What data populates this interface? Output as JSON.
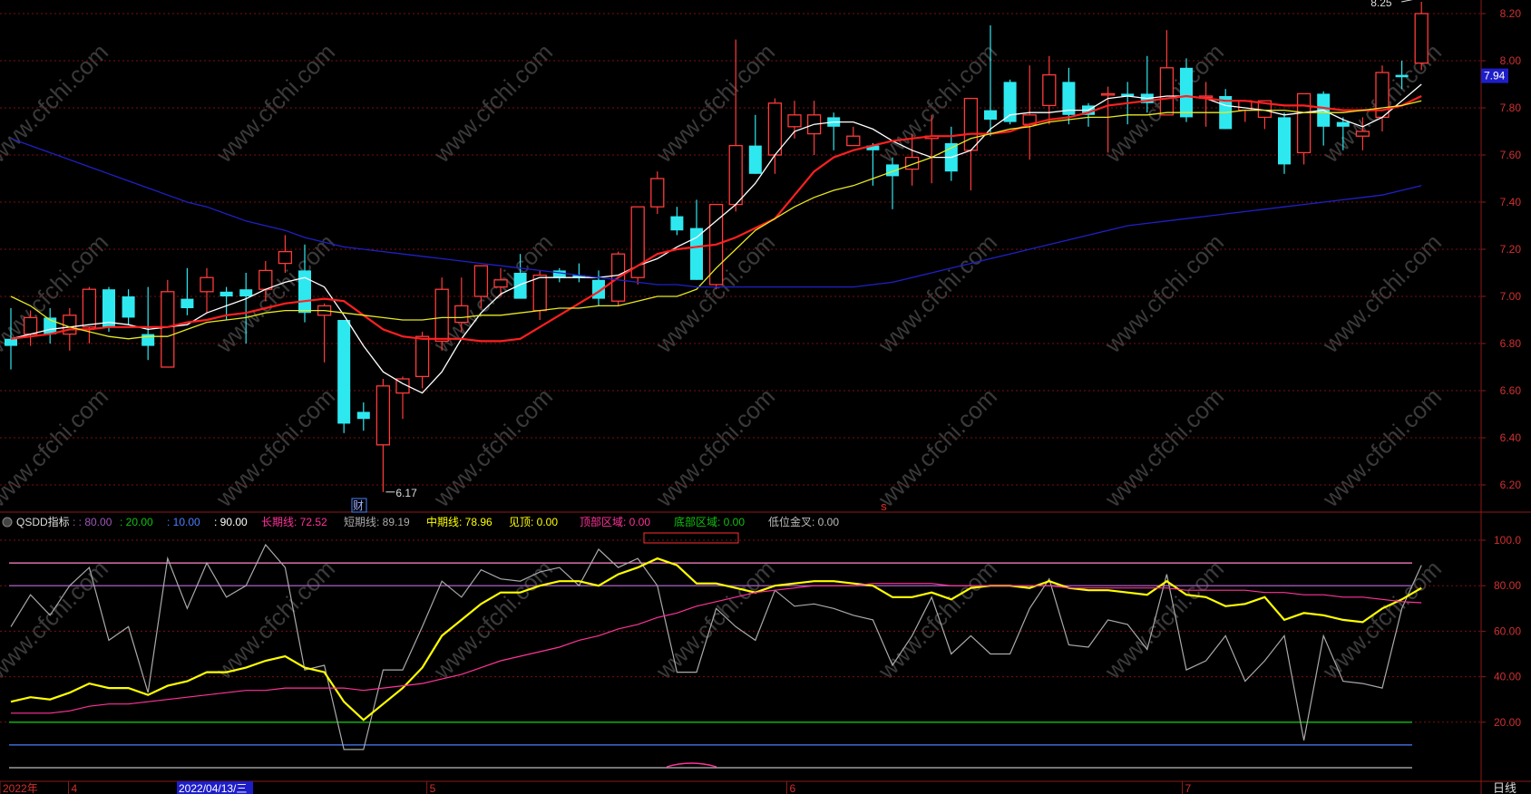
{
  "chart_data": [
    {
      "type": "candlestick",
      "ylim": [
        6.1,
        8.3
      ],
      "y_ticks": [
        "8.20",
        "8.00",
        "7.80",
        "7.60",
        "7.40",
        "7.20",
        "7.00",
        "6.80",
        "6.60",
        "6.40",
        "6.20"
      ],
      "last_price": "7.94",
      "high_label": "8.25",
      "low_label": "6.17",
      "event_label": "财",
      "marker_label": "S",
      "candles": [
        {
          "o": 6.82,
          "h": 6.95,
          "l": 6.69,
          "c": 6.79
        },
        {
          "o": 6.84,
          "h": 6.94,
          "l": 6.79,
          "c": 6.91
        },
        {
          "o": 6.91,
          "h": 6.95,
          "l": 6.8,
          "c": 6.84
        },
        {
          "o": 6.84,
          "h": 6.95,
          "l": 6.77,
          "c": 6.92
        },
        {
          "o": 6.87,
          "h": 7.04,
          "l": 6.8,
          "c": 7.03
        },
        {
          "o": 7.03,
          "h": 7.04,
          "l": 6.85,
          "c": 6.87
        },
        {
          "o": 7.0,
          "h": 7.03,
          "l": 6.88,
          "c": 6.91
        },
        {
          "o": 6.84,
          "h": 7.04,
          "l": 6.73,
          "c": 6.79
        },
        {
          "o": 6.7,
          "h": 7.07,
          "l": 6.7,
          "c": 7.02
        },
        {
          "o": 6.99,
          "h": 7.12,
          "l": 6.92,
          "c": 6.95
        },
        {
          "o": 7.02,
          "h": 7.12,
          "l": 6.93,
          "c": 7.08
        },
        {
          "o": 7.02,
          "h": 7.04,
          "l": 6.9,
          "c": 7.0
        },
        {
          "o": 7.03,
          "h": 7.1,
          "l": 6.8,
          "c": 7.0
        },
        {
          "o": 7.03,
          "h": 7.15,
          "l": 6.98,
          "c": 7.11
        },
        {
          "o": 7.14,
          "h": 7.26,
          "l": 7.1,
          "c": 7.19
        },
        {
          "o": 7.11,
          "h": 7.22,
          "l": 6.89,
          "c": 6.93
        },
        {
          "o": 6.92,
          "h": 6.97,
          "l": 6.72,
          "c": 6.96
        },
        {
          "o": 6.9,
          "h": 6.9,
          "l": 6.42,
          "c": 6.46
        },
        {
          "o": 6.51,
          "h": 6.55,
          "l": 6.43,
          "c": 6.48
        },
        {
          "o": 6.37,
          "h": 6.65,
          "l": 6.17,
          "c": 6.62
        },
        {
          "o": 6.59,
          "h": 6.66,
          "l": 6.48,
          "c": 6.65
        },
        {
          "o": 6.66,
          "h": 6.85,
          "l": 6.61,
          "c": 6.83
        },
        {
          "o": 6.81,
          "h": 7.08,
          "l": 6.77,
          "c": 7.03
        },
        {
          "o": 6.89,
          "h": 7.08,
          "l": 6.85,
          "c": 6.96
        },
        {
          "o": 7.0,
          "h": 7.13,
          "l": 6.95,
          "c": 7.13
        },
        {
          "o": 7.04,
          "h": 7.12,
          "l": 7.0,
          "c": 7.07
        },
        {
          "o": 7.1,
          "h": 7.18,
          "l": 7.0,
          "c": 6.99
        },
        {
          "o": 6.94,
          "h": 7.11,
          "l": 6.9,
          "c": 7.09
        },
        {
          "o": 7.11,
          "h": 7.12,
          "l": 7.06,
          "c": 7.08
        },
        {
          "o": 7.09,
          "h": 7.14,
          "l": 7.06,
          "c": 7.08
        },
        {
          "o": 7.07,
          "h": 7.11,
          "l": 6.96,
          "c": 6.99
        },
        {
          "o": 6.98,
          "h": 7.19,
          "l": 6.96,
          "c": 7.18
        },
        {
          "o": 7.08,
          "h": 7.38,
          "l": 7.05,
          "c": 7.38
        },
        {
          "o": 7.38,
          "h": 7.53,
          "l": 7.35,
          "c": 7.5
        },
        {
          "o": 7.34,
          "h": 7.38,
          "l": 7.26,
          "c": 7.28
        },
        {
          "o": 7.29,
          "h": 7.41,
          "l": 7.07,
          "c": 7.07
        },
        {
          "o": 7.05,
          "h": 7.39,
          "l": 7.03,
          "c": 7.39
        },
        {
          "o": 7.39,
          "h": 8.09,
          "l": 7.36,
          "c": 7.64
        },
        {
          "o": 7.64,
          "h": 7.77,
          "l": 7.52,
          "c": 7.52
        },
        {
          "o": 7.6,
          "h": 7.84,
          "l": 7.52,
          "c": 7.82
        },
        {
          "o": 7.72,
          "h": 7.83,
          "l": 7.67,
          "c": 7.77
        },
        {
          "o": 7.69,
          "h": 7.83,
          "l": 7.6,
          "c": 7.77
        },
        {
          "o": 7.76,
          "h": 7.78,
          "l": 7.62,
          "c": 7.72
        },
        {
          "o": 7.64,
          "h": 7.72,
          "l": 7.64,
          "c": 7.68
        },
        {
          "o": 7.64,
          "h": 7.65,
          "l": 7.47,
          "c": 7.62
        },
        {
          "o": 7.56,
          "h": 7.59,
          "l": 7.37,
          "c": 7.51
        },
        {
          "o": 7.54,
          "h": 7.69,
          "l": 7.47,
          "c": 7.59
        },
        {
          "o": 7.67,
          "h": 7.77,
          "l": 7.48,
          "c": 7.68
        },
        {
          "o": 7.65,
          "h": 7.72,
          "l": 7.49,
          "c": 7.53
        },
        {
          "o": 7.62,
          "h": 7.8,
          "l": 7.45,
          "c": 7.84
        },
        {
          "o": 7.79,
          "h": 8.15,
          "l": 7.68,
          "c": 7.75
        },
        {
          "o": 7.91,
          "h": 7.92,
          "l": 7.73,
          "c": 7.74
        },
        {
          "o": 7.73,
          "h": 7.98,
          "l": 7.58,
          "c": 7.77
        },
        {
          "o": 7.81,
          "h": 8.02,
          "l": 7.73,
          "c": 7.94
        },
        {
          "o": 7.91,
          "h": 7.97,
          "l": 7.73,
          "c": 7.77
        },
        {
          "o": 7.81,
          "h": 7.82,
          "l": 7.72,
          "c": 7.77
        },
        {
          "o": 7.86,
          "h": 7.89,
          "l": 7.61,
          "c": 7.86
        },
        {
          "o": 7.86,
          "h": 7.91,
          "l": 7.73,
          "c": 7.85
        },
        {
          "o": 7.86,
          "h": 8.02,
          "l": 7.78,
          "c": 7.82
        },
        {
          "o": 7.77,
          "h": 8.13,
          "l": 7.77,
          "c": 7.97
        },
        {
          "o": 7.97,
          "h": 8.01,
          "l": 7.74,
          "c": 7.76
        },
        {
          "o": 7.85,
          "h": 7.91,
          "l": 7.72,
          "c": 7.85
        },
        {
          "o": 7.85,
          "h": 7.88,
          "l": 7.71,
          "c": 7.71
        },
        {
          "o": 7.79,
          "h": 7.82,
          "l": 7.74,
          "c": 7.83
        },
        {
          "o": 7.76,
          "h": 7.83,
          "l": 7.71,
          "c": 7.83
        },
        {
          "o": 7.76,
          "h": 7.78,
          "l": 7.52,
          "c": 7.56
        },
        {
          "o": 7.61,
          "h": 7.85,
          "l": 7.56,
          "c": 7.86
        },
        {
          "o": 7.86,
          "h": 7.87,
          "l": 7.64,
          "c": 7.72
        },
        {
          "o": 7.74,
          "h": 7.76,
          "l": 7.62,
          "c": 7.72
        },
        {
          "o": 7.68,
          "h": 7.76,
          "l": 7.62,
          "c": 7.7
        },
        {
          "o": 7.76,
          "h": 7.98,
          "l": 7.7,
          "c": 7.95
        },
        {
          "o": 7.94,
          "h": 8.0,
          "l": 7.88,
          "c": 7.93
        },
        {
          "o": 7.99,
          "h": 8.25,
          "l": 7.96,
          "c": 8.2
        }
      ],
      "ma_lines": [
        {
          "color": "#ffffff",
          "values": [
            6.82,
            6.84,
            6.86,
            6.87,
            6.88,
            6.89,
            6.88,
            6.86,
            6.87,
            6.88,
            6.93,
            6.96,
            6.99,
            7.03,
            7.06,
            7.08,
            7.04,
            6.92,
            6.79,
            6.68,
            6.63,
            6.59,
            6.68,
            6.82,
            6.93,
            7.01,
            7.05,
            7.08,
            7.08,
            7.08,
            7.08,
            7.09,
            7.13,
            7.16,
            7.21,
            7.25,
            7.32,
            7.39,
            7.48,
            7.6,
            7.7,
            7.73,
            7.74,
            7.74,
            7.71,
            7.66,
            7.62,
            7.59,
            7.59,
            7.62,
            7.71,
            7.77,
            7.78,
            7.78,
            7.79,
            7.79,
            7.84,
            7.85,
            7.84,
            7.85,
            7.85,
            7.84,
            7.81,
            7.8,
            7.79,
            7.77,
            7.78,
            7.79,
            7.75,
            7.72,
            7.76,
            7.83,
            7.9
          ]
        },
        {
          "color": "#ff2020",
          "values": [
            6.82,
            6.83,
            6.84,
            6.86,
            6.86,
            6.87,
            6.87,
            6.87,
            6.87,
            6.89,
            6.9,
            6.92,
            6.93,
            6.95,
            6.97,
            6.98,
            6.99,
            6.98,
            6.92,
            6.86,
            6.83,
            6.82,
            6.82,
            6.82,
            6.81,
            6.81,
            6.82,
            6.87,
            6.92,
            6.97,
            7.02,
            7.08,
            7.13,
            7.18,
            7.2,
            7.21,
            7.22,
            7.25,
            7.29,
            7.33,
            7.43,
            7.53,
            7.59,
            7.62,
            7.64,
            7.66,
            7.67,
            7.68,
            7.68,
            7.69,
            7.69,
            7.7,
            7.73,
            7.75,
            7.76,
            7.78,
            7.81,
            7.82,
            7.83,
            7.84,
            7.85,
            7.84,
            7.83,
            7.83,
            7.82,
            7.81,
            7.81,
            7.8,
            7.79,
            7.79,
            7.79,
            7.81,
            7.85
          ]
        },
        {
          "color": "#e8e820",
          "values": [
            7.0,
            6.96,
            6.9,
            6.87,
            6.85,
            6.83,
            6.82,
            6.83,
            6.83,
            6.86,
            6.89,
            6.9,
            6.91,
            6.93,
            6.94,
            6.94,
            6.94,
            6.93,
            6.92,
            6.91,
            6.9,
            6.9,
            6.91,
            6.91,
            6.92,
            6.92,
            6.93,
            6.94,
            6.95,
            6.95,
            6.96,
            6.96,
            6.98,
            7.0,
            7.0,
            7.03,
            7.12,
            7.2,
            7.28,
            7.33,
            7.38,
            7.42,
            7.45,
            7.47,
            7.5,
            7.53,
            7.56,
            7.59,
            7.63,
            7.67,
            7.69,
            7.71,
            7.72,
            7.74,
            7.75,
            7.76,
            7.76,
            7.77,
            7.77,
            7.78,
            7.78,
            7.78,
            7.78,
            7.79,
            7.79,
            7.79,
            7.78,
            7.78,
            7.78,
            7.79,
            7.8,
            7.81,
            7.83
          ]
        },
        {
          "color": "#2020c8",
          "values": [
            7.67,
            7.64,
            7.61,
            7.58,
            7.55,
            7.52,
            7.49,
            7.46,
            7.43,
            7.4,
            7.38,
            7.35,
            7.32,
            7.3,
            7.28,
            7.25,
            7.23,
            7.21,
            7.2,
            7.19,
            7.18,
            7.17,
            7.16,
            7.15,
            7.14,
            7.13,
            7.12,
            7.11,
            7.1,
            7.09,
            7.08,
            7.07,
            7.06,
            7.05,
            7.05,
            7.04,
            7.04,
            7.04,
            7.04,
            7.04,
            7.04,
            7.04,
            7.04,
            7.04,
            7.05,
            7.06,
            7.08,
            7.1,
            7.12,
            7.14,
            7.16,
            7.18,
            7.2,
            7.22,
            7.24,
            7.26,
            7.28,
            7.3,
            7.31,
            7.32,
            7.33,
            7.34,
            7.35,
            7.36,
            7.37,
            7.38,
            7.39,
            7.4,
            7.41,
            7.42,
            7.43,
            7.45,
            7.47
          ]
        }
      ]
    },
    {
      "type": "line",
      "title": "QSDD指标",
      "ylim": [
        0,
        110
      ],
      "y_ticks": [
        "100.0",
        "80.00",
        "60.00",
        "40.00",
        "20.00"
      ],
      "legend": [
        {
          "label": "",
          "value": "80.00",
          "color": "#9b59b6"
        },
        {
          "label": "",
          "value": "20.00",
          "color": "#10c010"
        },
        {
          "label": "",
          "value": "10.00",
          "color": "#4a7fff"
        },
        {
          "label": "",
          "value": "90.00",
          "color": "#ffffff"
        },
        {
          "label": "长期线",
          "value": "72.52",
          "color": "#ff3399"
        },
        {
          "label": "短期线",
          "value": "89.19",
          "color": "#aaaaaa"
        },
        {
          "label": "中期线",
          "value": "78.96",
          "color": "#ffff00"
        },
        {
          "label": "见顶",
          "value": "0.00",
          "color": "#ffff00"
        },
        {
          "label": "顶部区域",
          "value": "0.00",
          "color": "#ff3399"
        },
        {
          "label": "底部区域",
          "value": "0.00",
          "color": "#10c010"
        },
        {
          "label": "低位金叉",
          "value": "0.00",
          "color": "#bbbbbb"
        }
      ],
      "reference_lines": [
        {
          "value": 90,
          "color": "#ff88cc"
        },
        {
          "value": 80,
          "color": "#9b59b6"
        },
        {
          "value": 20,
          "color": "#10c010"
        },
        {
          "value": 10,
          "color": "#4a7fff"
        },
        {
          "value": 0,
          "color": "#bbbbbb"
        }
      ],
      "series": [
        {
          "name": "短期线",
          "color": "#aaaaaa",
          "values": [
            62,
            76,
            67,
            80,
            88,
            56,
            62,
            33,
            92,
            70,
            90,
            75,
            80,
            98,
            88,
            43,
            45,
            8,
            8,
            43,
            43,
            62,
            82,
            75,
            87,
            83,
            82,
            86,
            88,
            80,
            96,
            88,
            92,
            80,
            42,
            42,
            70,
            62,
            56,
            78,
            71,
            72,
            70,
            67,
            65,
            45,
            58,
            75,
            50,
            58,
            50,
            50,
            70,
            83,
            54,
            53,
            65,
            63,
            52,
            85,
            43,
            47,
            58,
            38,
            47,
            58,
            12,
            58,
            38,
            37,
            35,
            70,
            89
          ]
        },
        {
          "name": "中期线",
          "color": "#ffff00",
          "values": [
            29,
            31,
            30,
            33,
            37,
            35,
            35,
            32,
            36,
            38,
            42,
            42,
            44,
            47,
            49,
            44,
            42,
            29,
            21,
            28,
            35,
            44,
            58,
            65,
            72,
            77,
            77,
            80,
            82,
            82,
            80,
            85,
            88,
            92,
            89,
            81,
            81,
            79,
            77,
            80,
            81,
            82,
            82,
            81,
            80,
            75,
            75,
            77,
            74,
            79,
            80,
            80,
            79,
            82,
            79,
            78,
            78,
            77,
            76,
            82,
            76,
            75,
            71,
            72,
            75,
            65,
            68,
            67,
            65,
            64,
            70,
            74,
            79
          ]
        },
        {
          "name": "长期线",
          "color": "#ff3399",
          "values": [
            24,
            24,
            24,
            25,
            27,
            28,
            28,
            29,
            30,
            31,
            32,
            33,
            34,
            34,
            35,
            35,
            35,
            35,
            34,
            35,
            36,
            37,
            39,
            41,
            44,
            47,
            49,
            51,
            53,
            56,
            58,
            61,
            63,
            66,
            68,
            71,
            73,
            75,
            77,
            78,
            79,
            80,
            80,
            80,
            81,
            81,
            81,
            81,
            80,
            80,
            80,
            80,
            80,
            80,
            79,
            79,
            79,
            79,
            79,
            79,
            78,
            78,
            78,
            78,
            77,
            77,
            76,
            76,
            75,
            75,
            74,
            73,
            72.5
          ]
        }
      ]
    }
  ],
  "x_axis": {
    "labels": [
      {
        "text": "2022年",
        "pos": 0.0
      },
      {
        "text": "4",
        "pos": 0.045
      },
      {
        "text": "5",
        "pos": 0.287
      },
      {
        "text": "6",
        "pos": 0.53
      },
      {
        "text": "7",
        "pos": 0.797
      }
    ]
  },
  "date_cursor": "2022/04/13/三",
  "period_label": "日线",
  "watermark": "www.cfchi.com"
}
